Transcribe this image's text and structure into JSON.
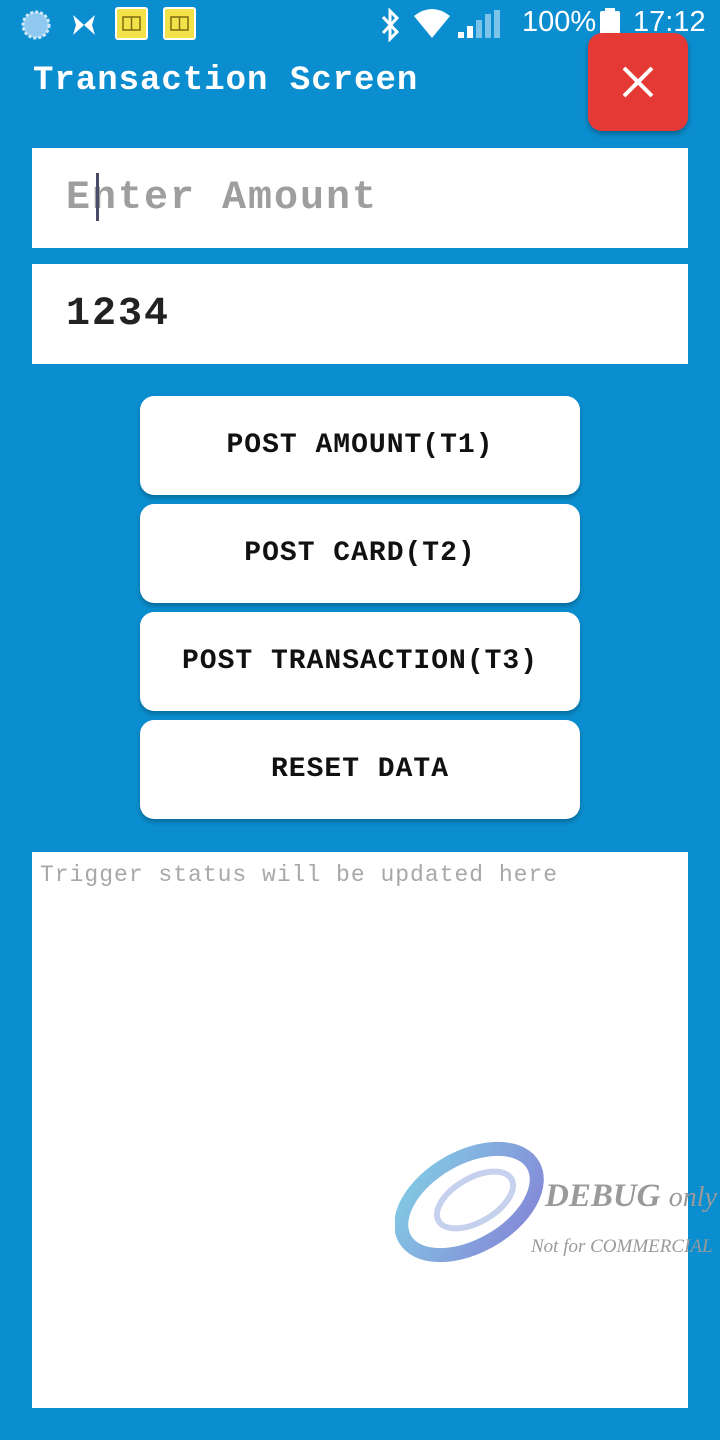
{
  "status_bar": {
    "icons_left": [
      "sync-icon",
      "butterfly-icon",
      "sim-card-icon",
      "sim-card-icon"
    ],
    "icons_right": [
      "bluetooth-icon",
      "wifi-icon",
      "signal-icon",
      "battery-icon"
    ],
    "battery": "100%",
    "time": "17:12"
  },
  "app": {
    "title": "Transaction Screen",
    "close_icon": "close-icon",
    "close_color": "#e53935",
    "background_color": "#0b8ecf"
  },
  "amount_field": {
    "placeholder": "Enter Amount",
    "value": ""
  },
  "pin_field": {
    "value": "1234"
  },
  "buttons": {
    "post_amount": "POST AMOUNT(T1)",
    "post_card": "POST CARD(T2)",
    "post_transaction": "POST TRANSACTION(T3)",
    "reset_data": "RESET DATA"
  },
  "status_area": {
    "placeholder": "Trigger status will be updated here"
  },
  "watermark": {
    "line1": "DEBUG",
    "line1_suffix": "only",
    "line2": "Not for COMMERCIAL"
  }
}
